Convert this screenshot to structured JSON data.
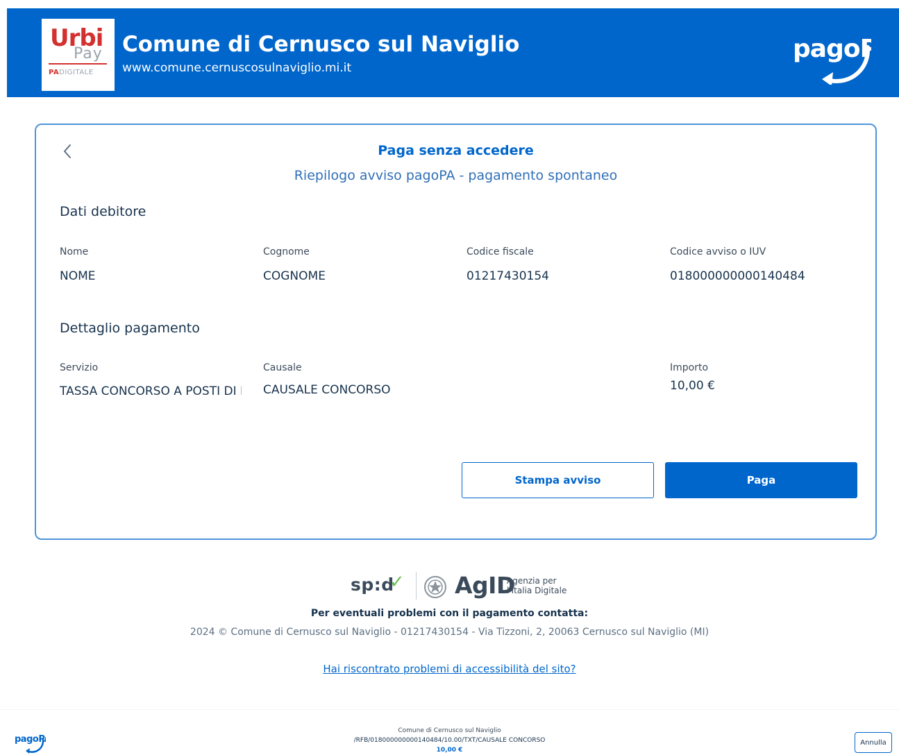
{
  "header": {
    "logo_urbi": "Urbi",
    "logo_pay": "Pay",
    "logo_pa": "PA",
    "logo_digitale": "DIGITALE",
    "title": "Comune di Cernusco sul Naviglio",
    "url": "www.comune.cernuscosulnaviglio.mi.it",
    "brand_logo": "pagoPA",
    "background_color": "#0066cc"
  },
  "card": {
    "back_icon": "chevron-left-icon",
    "title": "Paga senza accedere",
    "subtitle": "Riepilogo avviso pagoPA - pagamento spontaneo",
    "debtor_section": {
      "title": "Dati debitore",
      "fields": [
        {
          "label": "Nome",
          "value": "NOME"
        },
        {
          "label": "Cognome",
          "value": "COGNOME"
        },
        {
          "label": "Codice fiscale",
          "value": "01217430154"
        },
        {
          "label": "Codice avviso o IUV",
          "value": "018000000000140484"
        }
      ]
    },
    "payment_section": {
      "title": "Dettaglio pagamento",
      "fields": [
        {
          "label": "Servizio",
          "value": "TASSA CONCORSO A POSTI DI RUOLO"
        },
        {
          "label": "Causale",
          "value": "CAUSALE CONCORSO"
        },
        {
          "label": "Importo",
          "value": "10,00 €"
        }
      ]
    },
    "buttons": {
      "print_label": "Stampa avviso",
      "pay_label": "Paga"
    }
  },
  "footer": {
    "spid_logo": "sp:d",
    "agid_logo": "AgID",
    "agid_line1": "Agenzia per",
    "agid_line2": "l'Italia Digitale",
    "contact_title": "Per eventuali problemi con il pagamento contatta:",
    "contact_info": "2024 © Comune di Cernusco sul Naviglio - 01217430154 - Via Tizzoni, 2, 20063 Cernusco sul Naviglio (MI)",
    "accessibility_link": "Hai riscontrato problemi di accessibilità del sito?"
  },
  "bottom_bar": {
    "logo": "pagoPA",
    "entity": "Comune di Cernusco sul Naviglio",
    "reference": "/RFB/018000000000140484/10.00/TXT/CAUSALE CONCORSO",
    "amount": "10,00 €",
    "cancel_label": "Annulla"
  }
}
